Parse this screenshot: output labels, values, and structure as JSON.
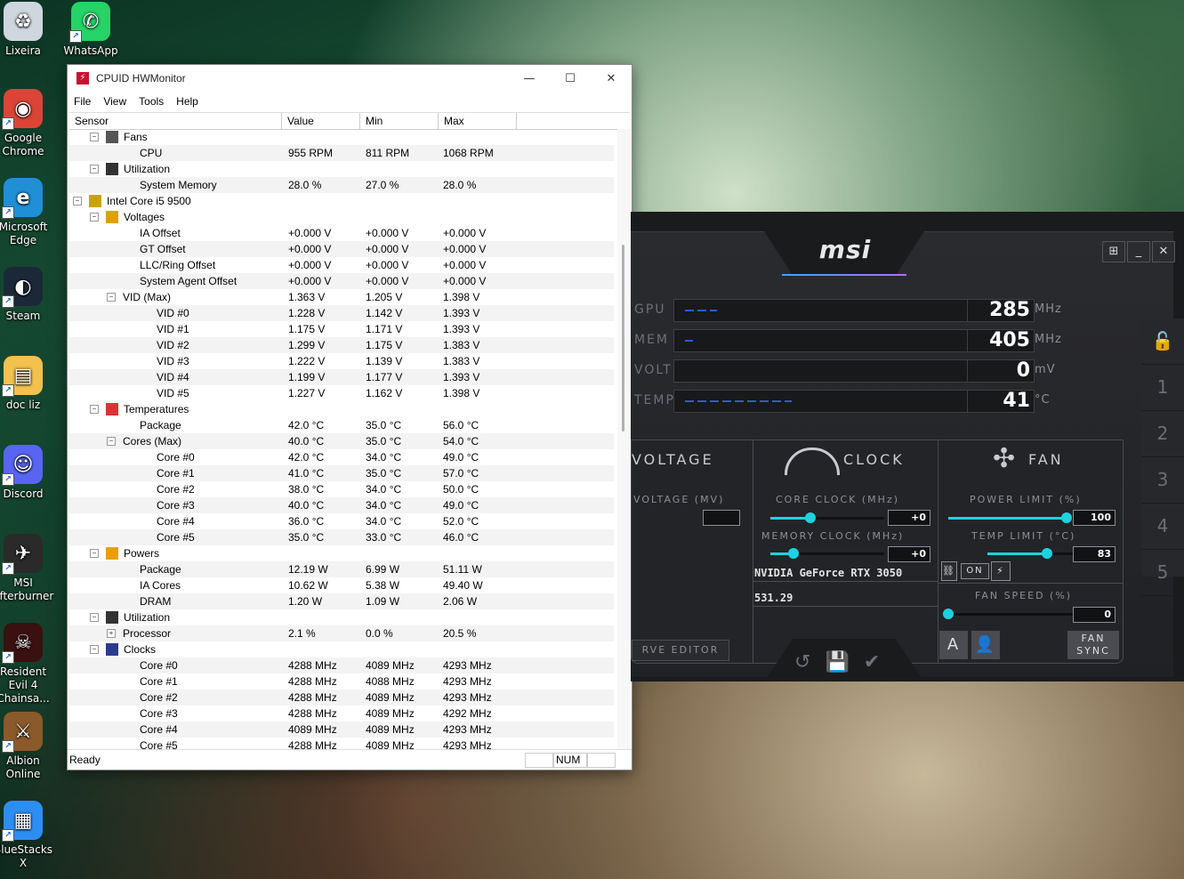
{
  "desktop": {
    "icons": [
      {
        "label": "Lixeira",
        "glyph": "♻",
        "color": "#cfd6de"
      },
      {
        "label": "WhatsApp",
        "glyph": "✆",
        "color": "#25d366"
      },
      {
        "label": "Google Chrome",
        "glyph": "◉",
        "color": "#db4437"
      },
      {
        "label": "Microsoft Edge",
        "glyph": "e",
        "color": "#1f8fd6"
      },
      {
        "label": "Steam",
        "glyph": "◐",
        "color": "#1b2838"
      },
      {
        "label": "doc liz",
        "glyph": "▤",
        "color": "#f2c14e"
      },
      {
        "label": "Discord",
        "glyph": "☺",
        "color": "#5865f2"
      },
      {
        "label": "MSI Afterburner",
        "glyph": "✈",
        "color": "#2a2a2a"
      },
      {
        "label": "Resident Evil 4 Chainsa...",
        "glyph": "☠",
        "color": "#3a1010"
      },
      {
        "label": "Albion Online",
        "glyph": "⚔",
        "color": "#8a5a2a"
      },
      {
        "label": "BlueStacks X",
        "glyph": "▦",
        "color": "#2d8ef2"
      }
    ]
  },
  "hwmonitor": {
    "title": "CPUID HWMonitor",
    "menu": [
      "File",
      "View",
      "Tools",
      "Help"
    ],
    "columns": [
      "Sensor",
      "Value",
      "Min",
      "Max"
    ],
    "status": "Ready",
    "status_num": "NUM",
    "rows": [
      {
        "indent": 2,
        "toggle": "−",
        "group_icon": "fan",
        "sensor": "Fans",
        "value": "",
        "min": "",
        "max": ""
      },
      {
        "indent": 4,
        "sensor": "CPU",
        "value": "955 RPM",
        "min": "811 RPM",
        "max": "1068 RPM"
      },
      {
        "indent": 2,
        "toggle": "−",
        "group_icon": "util",
        "sensor": "Utilization",
        "value": "",
        "min": "",
        "max": ""
      },
      {
        "indent": 4,
        "sensor": "System Memory",
        "value": "28.0 %",
        "min": "27.0 %",
        "max": "28.0 %"
      },
      {
        "indent": 1,
        "toggle": "−",
        "group_icon": "chip",
        "sensor": "Intel Core i5 9500",
        "value": "",
        "min": "",
        "max": ""
      },
      {
        "indent": 2,
        "toggle": "−",
        "group_icon": "volt",
        "sensor": "Voltages",
        "value": "",
        "min": "",
        "max": ""
      },
      {
        "indent": 4,
        "sensor": "IA Offset",
        "value": "+0.000 V",
        "min": "+0.000 V",
        "max": "+0.000 V"
      },
      {
        "indent": 4,
        "sensor": "GT Offset",
        "value": "+0.000 V",
        "min": "+0.000 V",
        "max": "+0.000 V"
      },
      {
        "indent": 4,
        "sensor": "LLC/Ring Offset",
        "value": "+0.000 V",
        "min": "+0.000 V",
        "max": "+0.000 V"
      },
      {
        "indent": 4,
        "sensor": "System Agent Offset",
        "value": "+0.000 V",
        "min": "+0.000 V",
        "max": "+0.000 V"
      },
      {
        "indent": 3,
        "toggle": "−",
        "sensor": "VID (Max)",
        "value": "1.363 V",
        "min": "1.205 V",
        "max": "1.398 V"
      },
      {
        "indent": 5,
        "sensor": "VID #0",
        "value": "1.228 V",
        "min": "1.142 V",
        "max": "1.393 V"
      },
      {
        "indent": 5,
        "sensor": "VID #1",
        "value": "1.175 V",
        "min": "1.171 V",
        "max": "1.393 V"
      },
      {
        "indent": 5,
        "sensor": "VID #2",
        "value": "1.299 V",
        "min": "1.175 V",
        "max": "1.383 V"
      },
      {
        "indent": 5,
        "sensor": "VID #3",
        "value": "1.222 V",
        "min": "1.139 V",
        "max": "1.383 V"
      },
      {
        "indent": 5,
        "sensor": "VID #4",
        "value": "1.199 V",
        "min": "1.177 V",
        "max": "1.393 V"
      },
      {
        "indent": 5,
        "sensor": "VID #5",
        "value": "1.227 V",
        "min": "1.162 V",
        "max": "1.398 V"
      },
      {
        "indent": 2,
        "toggle": "−",
        "group_icon": "temp",
        "sensor": "Temperatures",
        "value": "",
        "min": "",
        "max": ""
      },
      {
        "indent": 4,
        "sensor": "Package",
        "value": "42.0 °C",
        "min": "35.0 °C",
        "max": "56.0 °C"
      },
      {
        "indent": 3,
        "toggle": "−",
        "sensor": "Cores (Max)",
        "value": "40.0 °C",
        "min": "35.0 °C",
        "max": "54.0 °C"
      },
      {
        "indent": 5,
        "sensor": "Core #0",
        "value": "42.0 °C",
        "min": "34.0 °C",
        "max": "49.0 °C"
      },
      {
        "indent": 5,
        "sensor": "Core #1",
        "value": "41.0 °C",
        "min": "35.0 °C",
        "max": "57.0 °C"
      },
      {
        "indent": 5,
        "sensor": "Core #2",
        "value": "38.0 °C",
        "min": "34.0 °C",
        "max": "50.0 °C"
      },
      {
        "indent": 5,
        "sensor": "Core #3",
        "value": "40.0 °C",
        "min": "34.0 °C",
        "max": "49.0 °C"
      },
      {
        "indent": 5,
        "sensor": "Core #4",
        "value": "36.0 °C",
        "min": "34.0 °C",
        "max": "52.0 °C"
      },
      {
        "indent": 5,
        "sensor": "Core #5",
        "value": "35.0 °C",
        "min": "33.0 °C",
        "max": "46.0 °C"
      },
      {
        "indent": 2,
        "toggle": "−",
        "group_icon": "power",
        "sensor": "Powers",
        "value": "",
        "min": "",
        "max": ""
      },
      {
        "indent": 4,
        "sensor": "Package",
        "value": "12.19 W",
        "min": "6.99 W",
        "max": "51.11 W"
      },
      {
        "indent": 4,
        "sensor": "IA Cores",
        "value": "10.62 W",
        "min": "5.38 W",
        "max": "49.40 W"
      },
      {
        "indent": 4,
        "sensor": "DRAM",
        "value": "1.20 W",
        "min": "1.09 W",
        "max": "2.06 W"
      },
      {
        "indent": 2,
        "toggle": "−",
        "group_icon": "util",
        "sensor": "Utilization",
        "value": "",
        "min": "",
        "max": ""
      },
      {
        "indent": 3,
        "toggle": "+",
        "sensor": "Processor",
        "value": "2.1 %",
        "min": "0.0 %",
        "max": "20.5 %"
      },
      {
        "indent": 2,
        "toggle": "−",
        "group_icon": "clock",
        "sensor": "Clocks",
        "value": "",
        "min": "",
        "max": ""
      },
      {
        "indent": 4,
        "sensor": "Core #0",
        "value": "4288 MHz",
        "min": "4089 MHz",
        "max": "4293 MHz"
      },
      {
        "indent": 4,
        "sensor": "Core #1",
        "value": "4288 MHz",
        "min": "4088 MHz",
        "max": "4293 MHz"
      },
      {
        "indent": 4,
        "sensor": "Core #2",
        "value": "4288 MHz",
        "min": "4089 MHz",
        "max": "4293 MHz"
      },
      {
        "indent": 4,
        "sensor": "Core #3",
        "value": "4288 MHz",
        "min": "4089 MHz",
        "max": "4292 MHz"
      },
      {
        "indent": 4,
        "sensor": "Core #4",
        "value": "4089 MHz",
        "min": "4089 MHz",
        "max": "4293 MHz"
      },
      {
        "indent": 4,
        "sensor": "Core #5",
        "value": "4288 MHz",
        "min": "4089 MHz",
        "max": "4293 MHz"
      }
    ]
  },
  "afterburner": {
    "logo": "msi",
    "monitors": [
      {
        "label": "GPU",
        "value": "285",
        "unit": "MHz",
        "level": 0.12
      },
      {
        "label": "MEM",
        "value": "405",
        "unit": "MHz",
        "level": 0.03
      },
      {
        "label": "VOLT",
        "value": "0",
        "unit": "mV",
        "level": 0
      },
      {
        "label": "TEMP",
        "value": "41",
        "unit": "°C",
        "level": 0.4
      }
    ],
    "sections": {
      "voltage": "VOLTAGE",
      "clock": "CLOCK",
      "fan": "FAN"
    },
    "voltage_label": "VOLTAGE (MV)",
    "core_clock_label": "CORE CLOCK (MHz)",
    "core_clock_value": "+0",
    "core_clock_level": 0.35,
    "memory_clock_label": "MEMORY CLOCK (MHz)",
    "memory_clock_value": "+0",
    "memory_clock_level": 0.2,
    "power_limit_label": "POWER LIMIT (%)",
    "power_limit_value": "100",
    "power_limit_level": 0.95,
    "temp_limit_label": "TEMP LIMIT (°C)",
    "temp_limit_value": "83",
    "temp_limit_level": 0.7,
    "fan_speed_label": "FAN SPEED (%)",
    "fan_speed_value": "0",
    "fan_speed_level": 0,
    "link_on": "ON",
    "gpu_name": "NVIDIA GeForce RTX 3050",
    "driver": "531.29",
    "curve_editor": "RVE EDITOR",
    "fan_sync": "FAN SYNC",
    "fan_auto": "A",
    "profiles": [
      "🔓",
      "1",
      "2",
      "3",
      "4",
      "5"
    ],
    "accent": "#1bd3e0"
  }
}
